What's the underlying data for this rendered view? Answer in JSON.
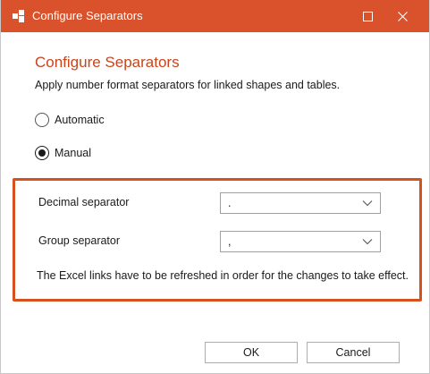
{
  "window": {
    "title": "Configure Separators",
    "maximize_icon": "maximize-icon",
    "close_icon": "close-icon",
    "app_icon": "app-logo-icon",
    "accent_color": "#d9522b"
  },
  "header": {
    "title": "Configure Separators",
    "subtitle": "Apply number format separators for linked shapes and tables.",
    "title_color": "#c8451d"
  },
  "mode": {
    "options": [
      {
        "label": "Automatic",
        "selected": false
      },
      {
        "label": "Manual",
        "selected": true
      }
    ]
  },
  "separators": {
    "decimal": {
      "label": "Decimal separator",
      "value": "."
    },
    "group": {
      "label": "Group separator",
      "value": ","
    },
    "note": "The Excel links have to be refreshed in order for the changes to take effect.",
    "highlight_color": "#d4521e"
  },
  "buttons": {
    "ok": "OK",
    "cancel": "Cancel"
  }
}
